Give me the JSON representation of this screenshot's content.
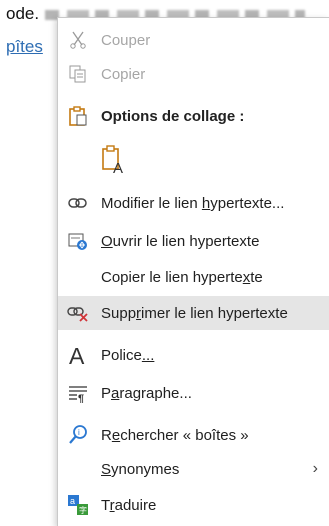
{
  "document": {
    "line1_text": "ode.",
    "line2_link_text": "pîtes"
  },
  "menu": {
    "cut": {
      "label": "Couper",
      "underline_index": 0,
      "icon": "scissors-icon"
    },
    "copy": {
      "label": "Copier",
      "underline_index": 0,
      "icon": "copy-icon"
    },
    "paste_options": {
      "label": "Options de collage :",
      "icon": "clipboard-icon"
    },
    "paste_text_only": {
      "icon": "paste-text-only-icon"
    },
    "edit_link": {
      "label_before": "Modifier le lien ",
      "label_u": "h",
      "label_after": "ypertexte...",
      "icon": "link-icon"
    },
    "open_link": {
      "label_before": "",
      "label_u": "O",
      "label_after": "uvrir le lien hypertexte",
      "icon": "open-link-icon"
    },
    "copy_link": {
      "label_before": "Copier le lien hyperte",
      "label_u": "x",
      "label_after": "te"
    },
    "remove_link": {
      "label_before": "Supp",
      "label_u": "r",
      "label_after": "imer le lien hypertexte",
      "icon": "remove-link-icon",
      "highlighted": true
    },
    "font": {
      "label_before": "Police",
      "label_u": "...",
      "label_after": "",
      "icon": "font-icon"
    },
    "paragraph": {
      "label_before": "P",
      "label_u": "a",
      "label_after": "ragraphe...",
      "icon": "paragraph-icon"
    },
    "search": {
      "label_before": "R",
      "label_u": "e",
      "label_after": "chercher « boîtes »",
      "icon": "search-icon"
    },
    "synonyms": {
      "label_before": "",
      "label_u": "S",
      "label_after": "ynonymes",
      "submenu_arrow": "›"
    },
    "translate": {
      "label_before": "T",
      "label_u": "r",
      "label_after": "aduire",
      "icon": "translate-icon"
    }
  },
  "colors": {
    "highlight_bg": "#e5e5e5",
    "disabled_text": "#a6a6a6",
    "accent_blue": "#2b78d1",
    "danger_red": "#d13438"
  }
}
